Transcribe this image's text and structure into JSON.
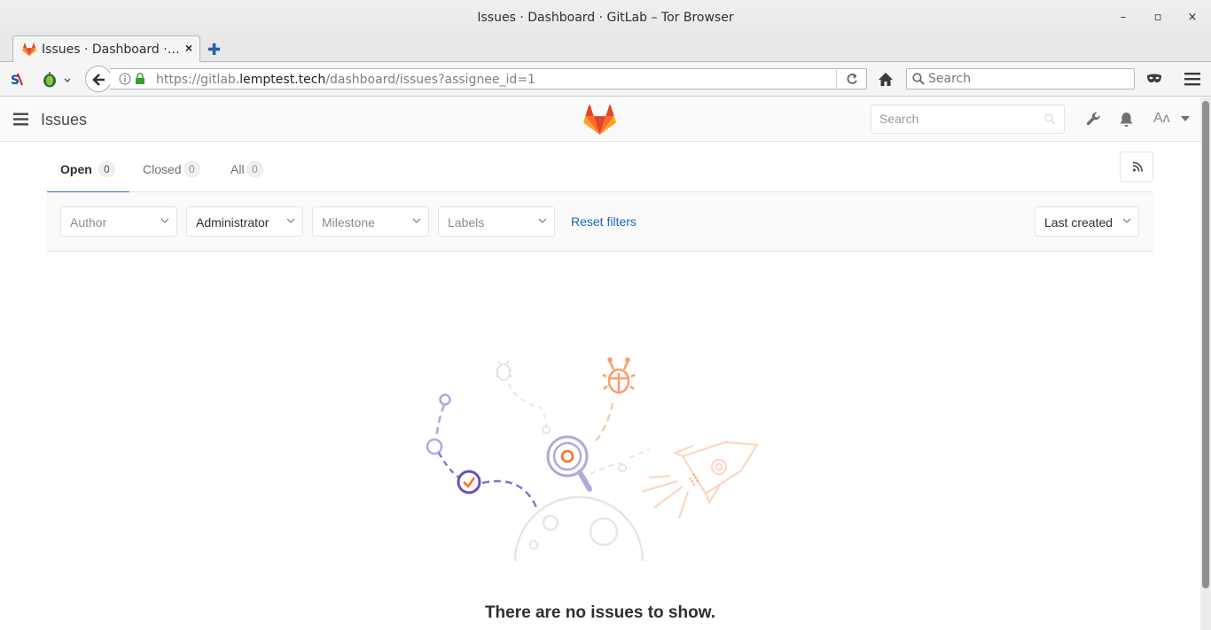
{
  "window": {
    "title": "Issues · Dashboard · GitLab – Tor Browser",
    "minimize_glyph": "–",
    "maximize_glyph": "▫",
    "close_glyph": "×"
  },
  "browser_tab": {
    "label": "Issues · Dashboard ·…",
    "close_glyph": "×",
    "new_tab_glyph": "✚"
  },
  "navbar": {
    "url_prefix": "https://gitlab.",
    "url_domain": "lemptest.tech",
    "url_path": "/dashboard/issues?assignee_id=1",
    "search_placeholder": "Search"
  },
  "gitlab_header": {
    "page_title": "Issues",
    "search_placeholder": "Search",
    "avatar_text": "Aʌ"
  },
  "state_tabs": [
    {
      "label": "Open",
      "count": "0",
      "active": true
    },
    {
      "label": "Closed",
      "count": "0",
      "active": false
    },
    {
      "label": "All",
      "count": "0",
      "active": false
    }
  ],
  "filters": {
    "author": "Author",
    "assignee": "Administrator",
    "milestone": "Milestone",
    "labels": "Labels",
    "reset": "Reset filters",
    "sort": "Last created"
  },
  "empty_state": {
    "message": "There are no issues to show."
  },
  "colors": {
    "accent_blue": "#1f78d1",
    "link_blue": "#1b69b6",
    "gitlab_orange": "#fc6d26",
    "gitlab_red": "#e24329",
    "purple": "#6b4fbb"
  }
}
